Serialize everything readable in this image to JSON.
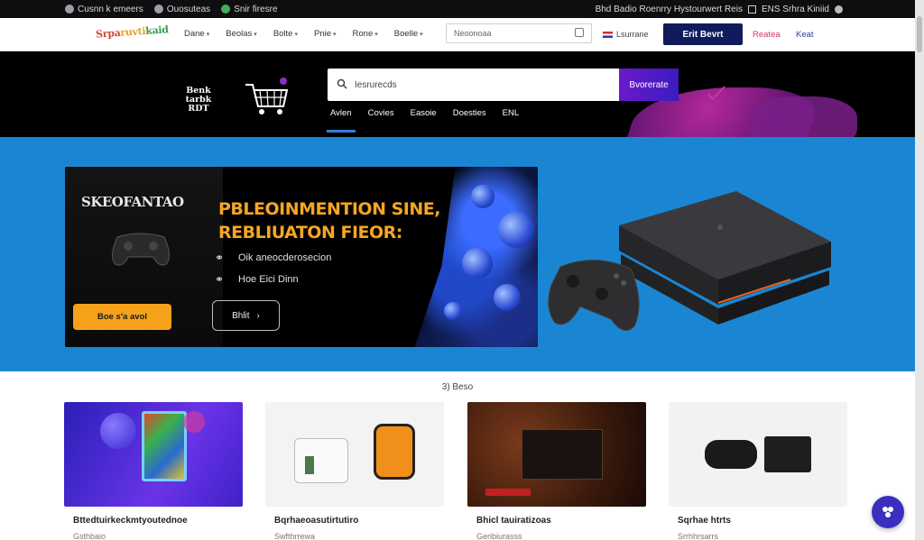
{
  "utility": {
    "items": [
      "Cusnn k emeers",
      "Ouosuteas",
      "Snir firesre"
    ],
    "right_text": "Bhd Badio Roenrry Hystourwert Reis",
    "right_extra": "ENS Srhra Kiniid"
  },
  "nav": {
    "logo_parts": [
      "Srpa",
      "ruvti",
      "kaid"
    ],
    "menu": [
      "Dane",
      "Beolas",
      "Bolte",
      "Pnie",
      "Rone",
      "Boelle"
    ],
    "search_placeholder": "Neoonoaa",
    "lang": "Lsurrane",
    "cta": "Erit Bevrt",
    "link1": "Reatea",
    "link2": "Keat"
  },
  "strip": {
    "store_name": "Benk tarbk RDT",
    "search_placeholder": "Iesrurecds",
    "search_button": "Bvorerate",
    "categories": [
      "Avlen",
      "Covies",
      "Easoie",
      "Doesties",
      "ENL"
    ]
  },
  "hero": {
    "thumb_title": "SKEOFANTAO",
    "headline_line1": "PBLEOINMENTION SINE,",
    "headline_line2": "REBLIUATON FIEOR:",
    "feature1": "Oik aneocderosecion",
    "feature2": "Hoe Eici Dinn",
    "btn_primary": "Boe s'a avol",
    "btn_secondary": "Bhlit"
  },
  "section": {
    "label": "3) Beso"
  },
  "cards": [
    {
      "title": "Bttedtuirkeckmtyoutednoe",
      "sub": "Gsthbaio"
    },
    {
      "title": "Bqrhaeoasutirtutiro",
      "sub": "Swfthrrewa"
    },
    {
      "title": "Bhicl tauiratizoas",
      "sub": "Geribiurasss"
    },
    {
      "title": "Sqrhae htrts",
      "sub": "Srrhhrsarrs"
    }
  ],
  "colors": {
    "hero_blue": "#1a86d3",
    "accent_orange": "#f5a11a",
    "nav_cta": "#101b5c",
    "search_btn": "#4a1ac6"
  }
}
